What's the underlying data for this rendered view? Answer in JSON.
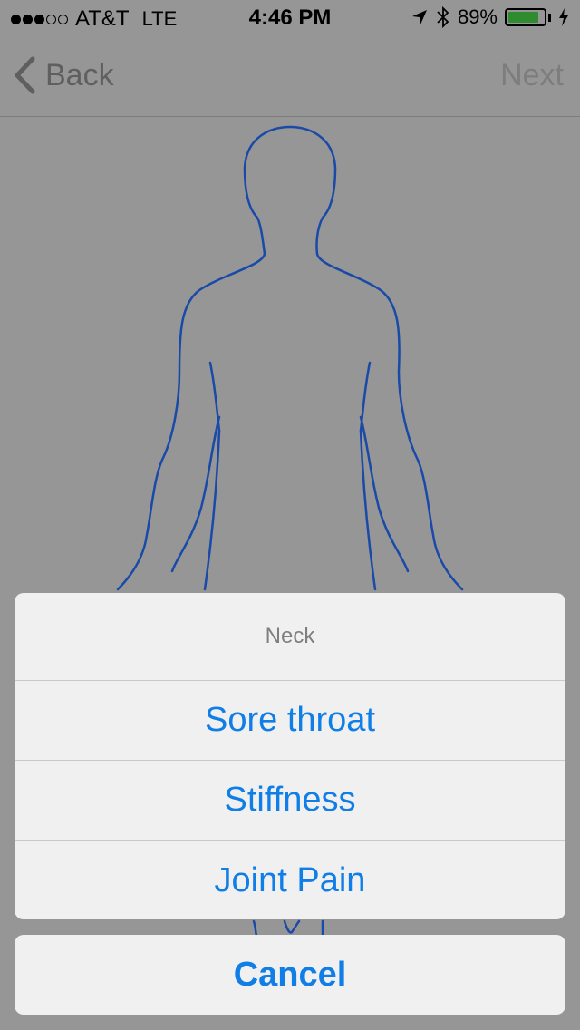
{
  "status_bar": {
    "carrier": "AT&T",
    "network": "LTE",
    "time": "4:46 PM",
    "battery_percent": "89%",
    "battery_level": 0.89,
    "signal_bars": 3,
    "icons": [
      "location-arrow-icon",
      "bluetooth-icon",
      "battery-icon",
      "charging-bolt-icon"
    ]
  },
  "nav": {
    "back_label": "Back",
    "next_label": "Next"
  },
  "figure": {
    "icon": "human-body-outline",
    "stroke_color": "#1a4aa8"
  },
  "action_sheet": {
    "title": "Neck",
    "options": [
      "Sore throat",
      "Stiffness",
      "Joint Pain"
    ],
    "cancel_label": "Cancel"
  },
  "colors": {
    "accent": "#0f7ee6",
    "overlay_background": "#969696",
    "sheet_background": "#f0f0f0"
  }
}
